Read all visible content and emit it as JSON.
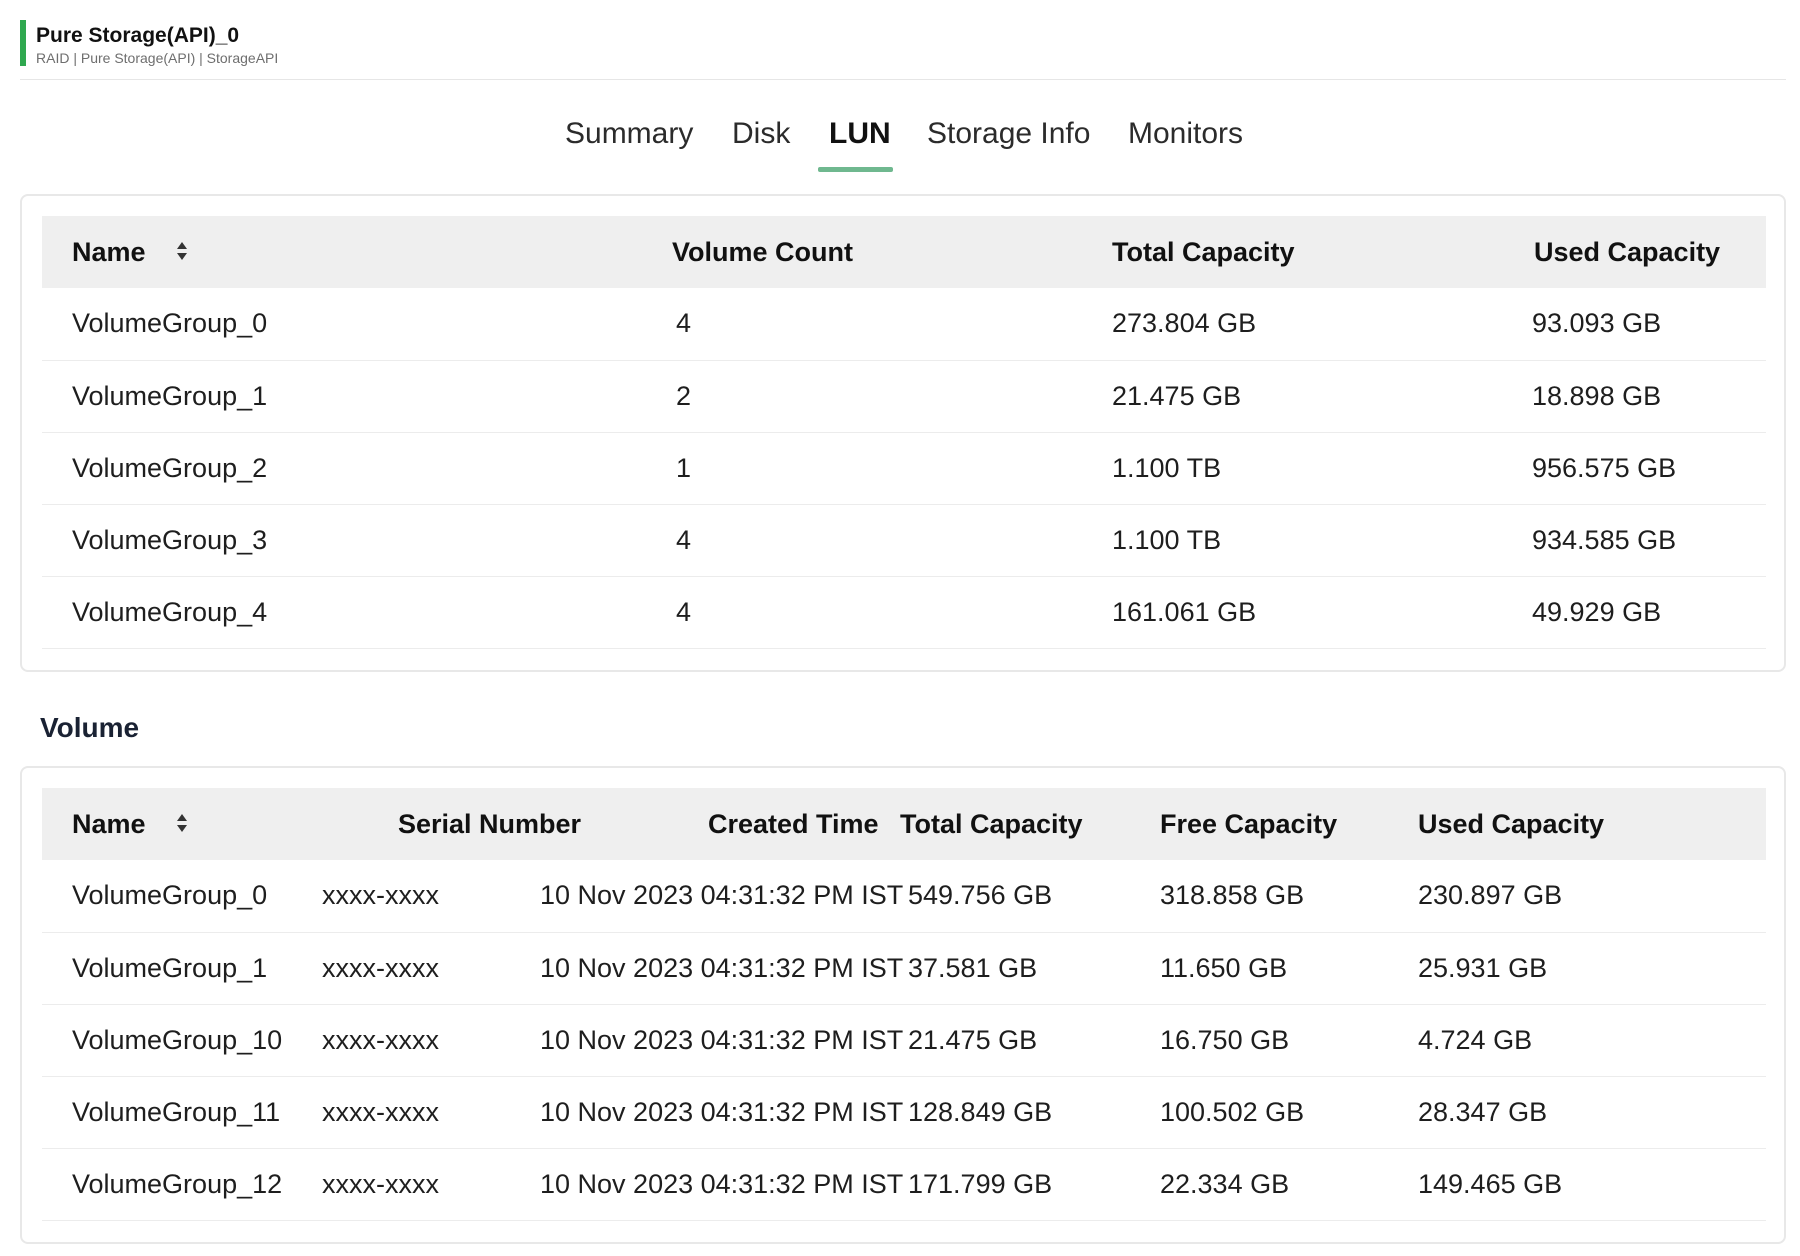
{
  "header": {
    "title": "Pure Storage(API)_0",
    "subtitle": "RAID | Pure Storage(API) | StorageAPI"
  },
  "tabs": [
    {
      "label": "Summary",
      "active": false
    },
    {
      "label": "Disk",
      "active": false
    },
    {
      "label": "LUN",
      "active": true
    },
    {
      "label": "Storage Info",
      "active": false
    },
    {
      "label": "Monitors",
      "active": false
    }
  ],
  "lun_table": {
    "columns": [
      "Name",
      "Volume Count",
      "Total Capacity",
      "Used Capacity"
    ],
    "rows": [
      [
        "VolumeGroup_0",
        "4",
        "273.804 GB",
        "93.093 GB"
      ],
      [
        "VolumeGroup_1",
        "2",
        "21.475 GB",
        "18.898 GB"
      ],
      [
        "VolumeGroup_2",
        "1",
        "1.100 TB",
        "956.575 GB"
      ],
      [
        "VolumeGroup_3",
        "4",
        "1.100 TB",
        "934.585 GB"
      ],
      [
        "VolumeGroup_4",
        "4",
        "161.061 GB",
        "49.929 GB"
      ]
    ]
  },
  "volume_section": {
    "title": "Volume"
  },
  "volume_table": {
    "columns": [
      "Name",
      "Serial Number",
      "Created Time",
      "Total Capacity",
      "Free Capacity",
      "Used Capacity"
    ],
    "rows": [
      [
        "VolumeGroup_0",
        "xxxx-xxxx",
        "10 Nov 2023 04:31:32 PM IST",
        "549.756 GB",
        "318.858 GB",
        "230.897 GB"
      ],
      [
        "VolumeGroup_1",
        "xxxx-xxxx",
        "10 Nov 2023 04:31:32 PM IST",
        "37.581 GB",
        "11.650 GB",
        "25.931 GB"
      ],
      [
        "VolumeGroup_10",
        "xxxx-xxxx",
        "10 Nov 2023 04:31:32 PM IST",
        "21.475 GB",
        "16.750 GB",
        "4.724 GB"
      ],
      [
        "VolumeGroup_11",
        "xxxx-xxxx",
        "10 Nov 2023 04:31:32 PM IST",
        "128.849 GB",
        "100.502 GB",
        "28.347 GB"
      ],
      [
        "VolumeGroup_12",
        "xxxx-xxxx",
        "10 Nov 2023 04:31:32 PM IST",
        "171.799 GB",
        "22.334 GB",
        "149.465 GB"
      ]
    ]
  },
  "colors": {
    "accent": "#2fa84f",
    "tab_underline": "#6fb88f",
    "header_bg": "#efefef"
  }
}
